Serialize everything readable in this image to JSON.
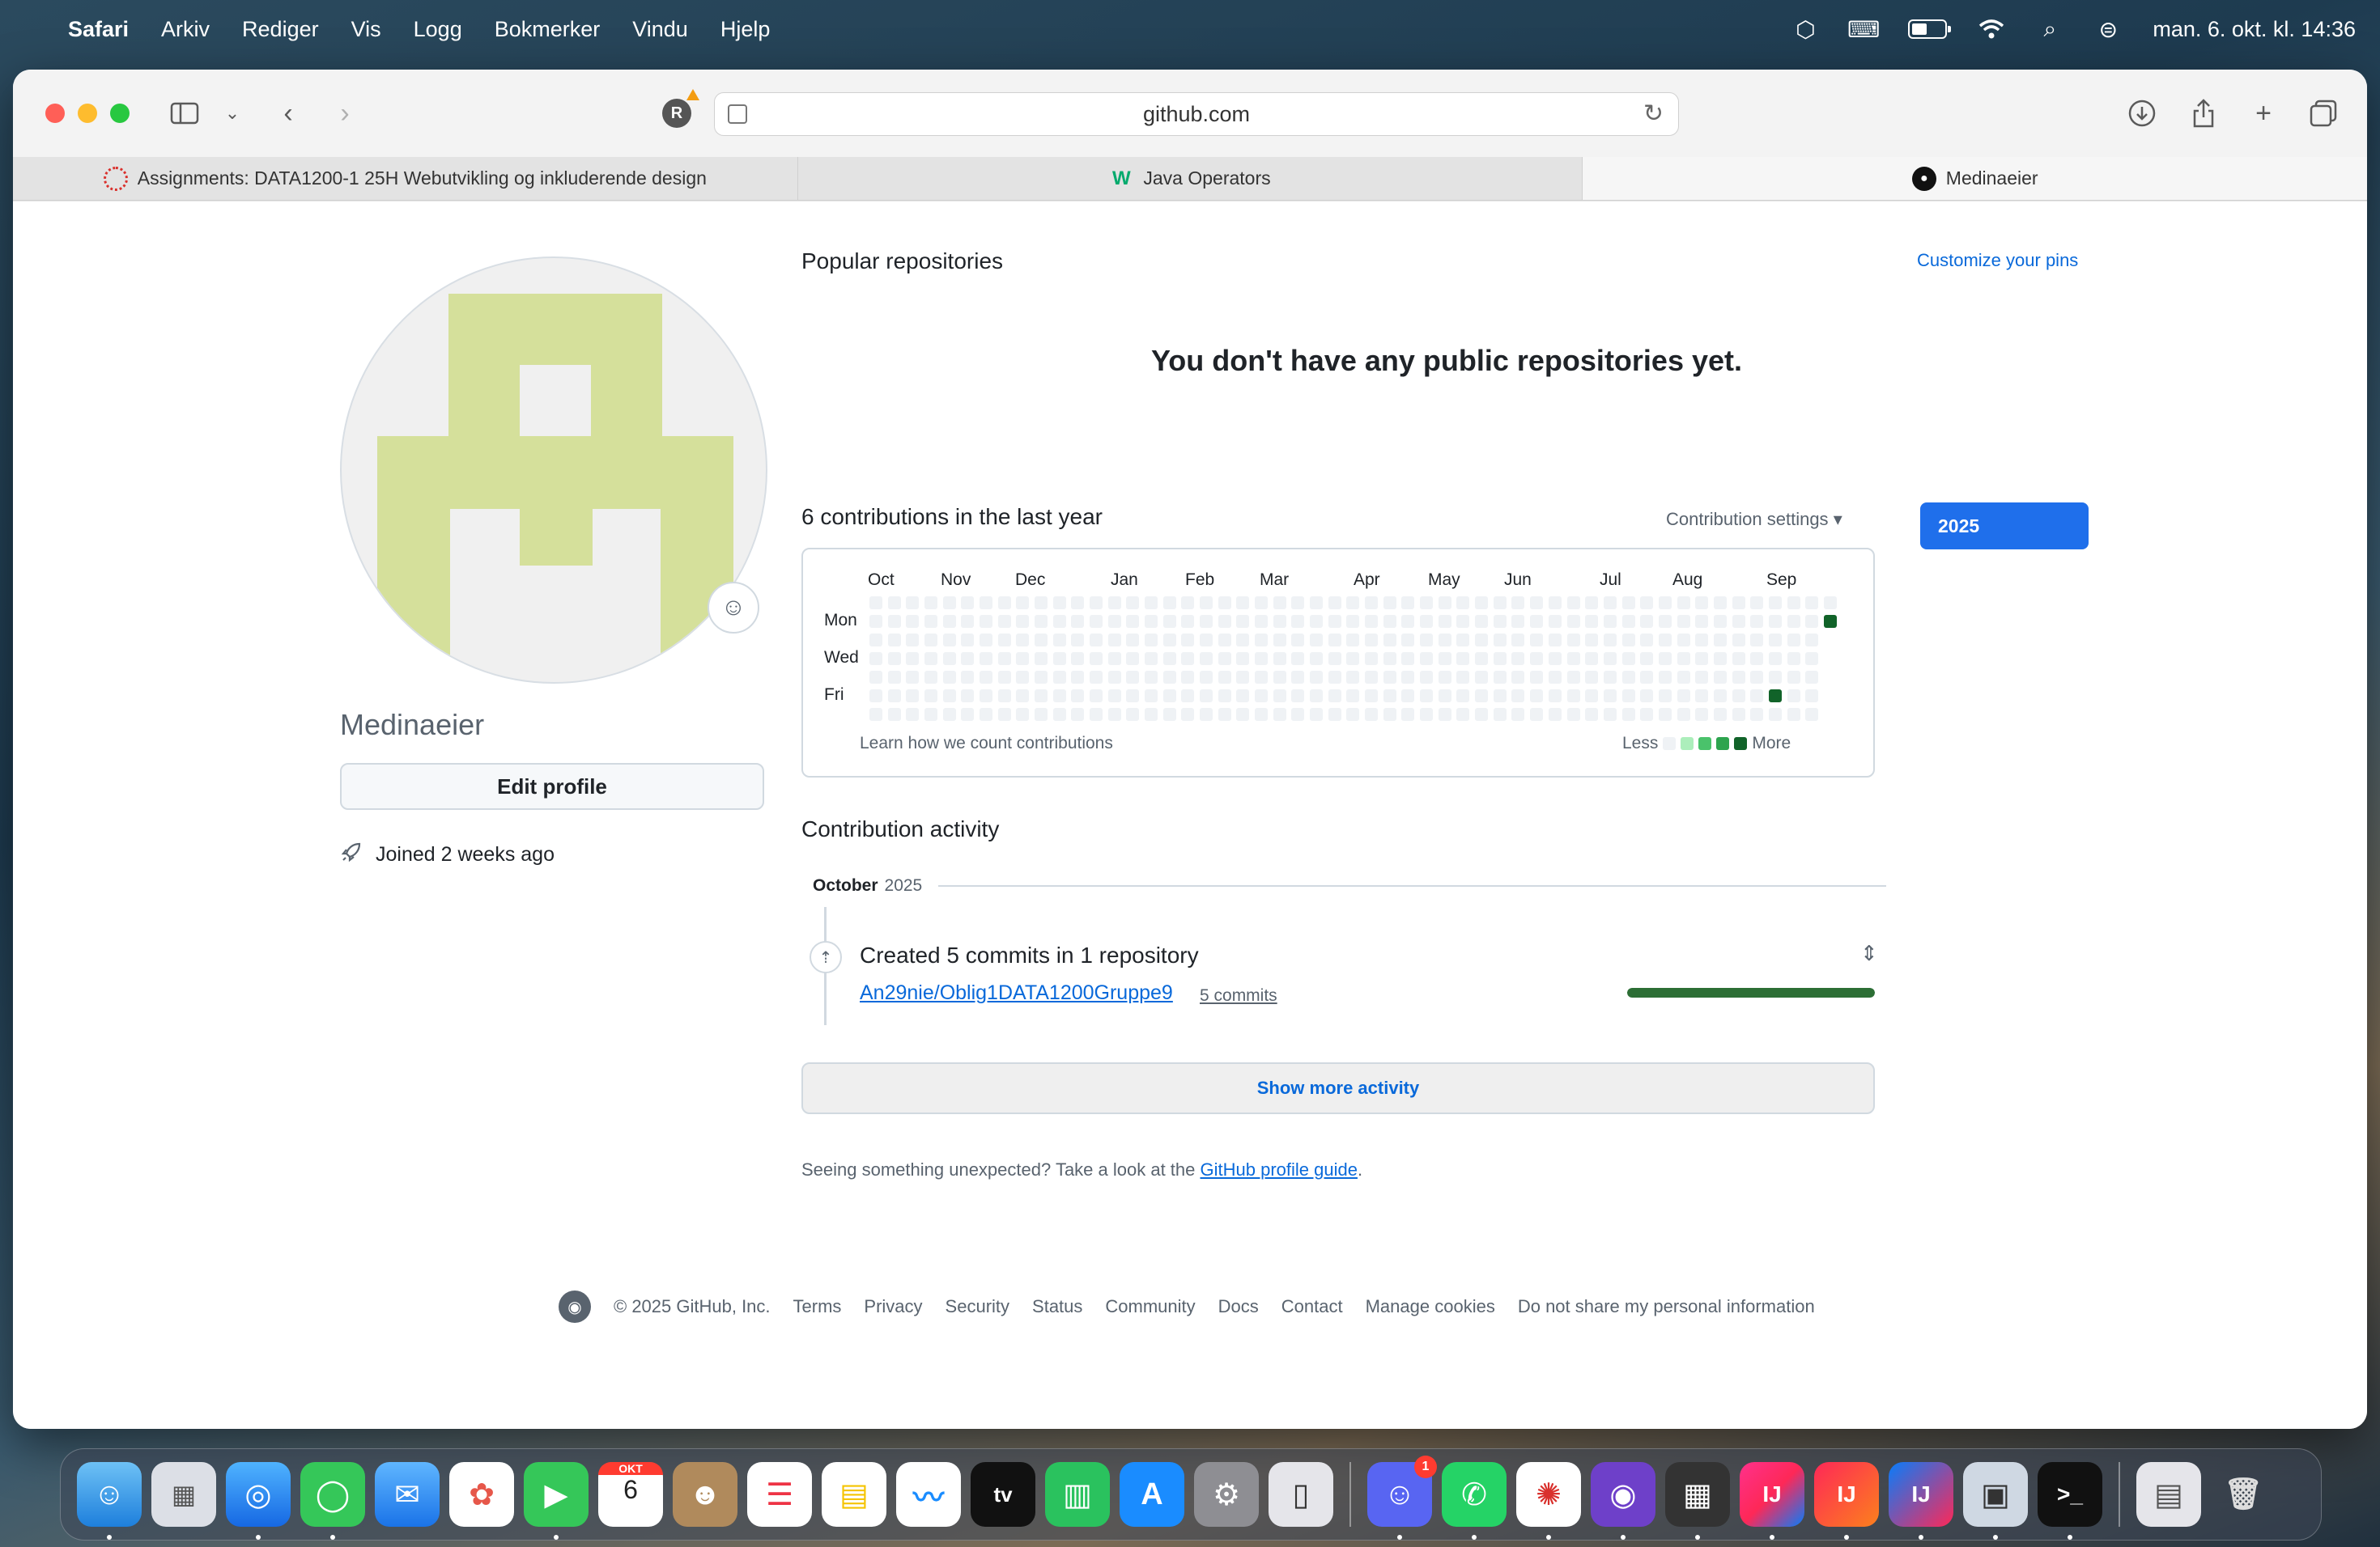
{
  "menubar": {
    "app_name": "Safari",
    "items": [
      "Arkiv",
      "Rediger",
      "Vis",
      "Logg",
      "Bokmerker",
      "Vindu",
      "Hjelp"
    ],
    "clock": "man. 6. okt. kl. 14:36"
  },
  "browser": {
    "url": "github.com",
    "tabs": [
      {
        "label": "Assignments: DATA1200-1 25H Webutvikling og inkluderende design",
        "icon": "canvas-icon"
      },
      {
        "label": "Java Operators",
        "icon": "w3schools-icon"
      },
      {
        "label": "Medinaeier",
        "icon": "github-icon"
      }
    ]
  },
  "profile": {
    "username": "Medinaeier",
    "edit_label": "Edit profile",
    "joined": "Joined 2 weeks ago"
  },
  "repos": {
    "title": "Popular repositories",
    "customize": "Customize your pins",
    "empty": "You don't have any public repositories yet."
  },
  "contributions": {
    "title": "6 contributions in the last year",
    "settings": "Contribution settings",
    "year": "2025",
    "months": [
      "Oct",
      "Nov",
      "Dec",
      "Jan",
      "Feb",
      "Mar",
      "Apr",
      "May",
      "Jun",
      "Jul",
      "Aug",
      "Sep"
    ],
    "days": [
      "Mon",
      "Wed",
      "Fri"
    ],
    "learn": "Learn how we count contributions",
    "less": "Less",
    "more": "More",
    "colors": [
      "#eff2f5",
      "#aceebb",
      "#4ac26b",
      "#2da44e",
      "#116329"
    ]
  },
  "activity": {
    "title": "Contribution activity",
    "month": "October",
    "year": "2025",
    "summary": "Created 5 commits in 1 repository",
    "repo": "An29nie/Oblig1DATA1200Gruppe9",
    "commits": "5 commits",
    "share": 1.0,
    "show_more": "Show more activity",
    "unexpected_text": "Seeing something unexpected? Take a look at the",
    "guide_link": "GitHub profile guide",
    "period": "."
  },
  "footer": {
    "copyright": "© 2025 GitHub, Inc.",
    "links": [
      "Terms",
      "Privacy",
      "Security",
      "Status",
      "Community",
      "Docs",
      "Contact",
      "Manage cookies",
      "Do not share my personal information"
    ]
  },
  "dock": {
    "calendar_month": "OKT",
    "calendar_day": "6",
    "discord_badge": "1"
  }
}
